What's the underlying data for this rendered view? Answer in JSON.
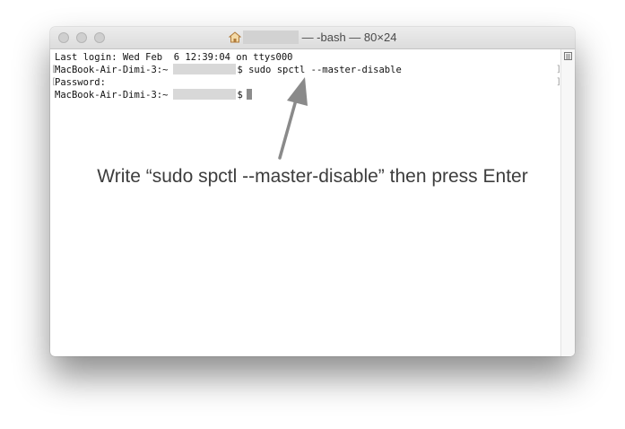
{
  "window": {
    "title": "— -bash — 80×24"
  },
  "terminal": {
    "lines": [
      "Last login: Wed Feb  6 12:39:04 on ttys000",
      "MacBook-Air-Dimi-3:~",
      "$ sudo spctl --master-disable",
      "Password:",
      "MacBook-Air-Dimi-3:~",
      "$"
    ]
  },
  "annotation": {
    "text": "Write “sudo spctl --master-disable” then press Enter"
  },
  "icons": {
    "home": "home-icon",
    "scroll": "scroll-lines-icon",
    "arrow": "arrow-up-icon"
  },
  "colors": {
    "arrow": "#8a8a8a",
    "text": "#111111",
    "annotation": "#3d3d3d"
  }
}
